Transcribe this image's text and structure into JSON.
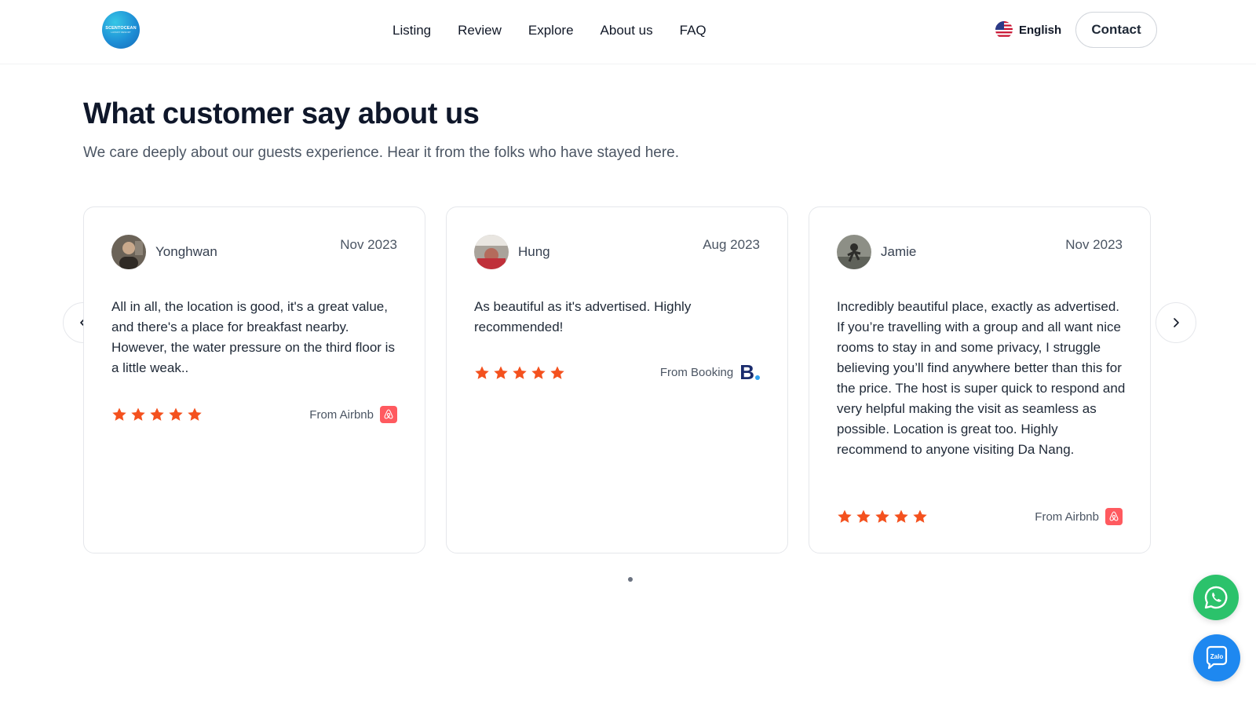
{
  "header": {
    "logo_text": "SCENTOCEAN",
    "logo_subtext": "LUXURY RESORT",
    "nav": [
      "Listing",
      "Review",
      "Explore",
      "About us",
      "FAQ"
    ],
    "language": "English",
    "contact_label": "Contact"
  },
  "section": {
    "title": "What customer say about us",
    "subtitle": "We care deeply about our guests experience. Hear it from the folks who have stayed here."
  },
  "reviews": [
    {
      "name": "Yonghwan",
      "date": "Nov 2023",
      "text": "All in all, the location is good, it's a great value, and there's a place for breakfast nearby. However, the water pressure on the third floor is a little weak..",
      "rating": 5,
      "source_label": "From Airbnb",
      "source_icon": "airbnb-icon"
    },
    {
      "name": "Hung",
      "date": "Aug 2023",
      "text": "As beautiful as it's advertised. Highly recommended!",
      "rating": 5,
      "source_label": "From Booking",
      "source_icon": "booking-icon",
      "source_logo_text": "B"
    },
    {
      "name": "Jamie",
      "date": "Nov 2023",
      "text": "Incredibly beautiful place, exactly as advertised. If you’re travelling with a group and all want nice rooms to stay in and some privacy, I struggle believing you’ll find anywhere better than this for the price. The host is super quick to respond and very helpful making the visit as seamless as possible. Location is great too. Highly recommend to anyone visiting Da Nang.",
      "rating": 5,
      "source_label": "From Airbnb",
      "source_icon": "airbnb-icon"
    }
  ],
  "floating": {
    "zalo_label": "Zalo"
  },
  "colors": {
    "star": "#f4511e",
    "airbnb": "#ff5a5f",
    "booking": "#1a2b6d",
    "whatsapp": "#2bc26b",
    "zalo": "#1e88f0"
  }
}
